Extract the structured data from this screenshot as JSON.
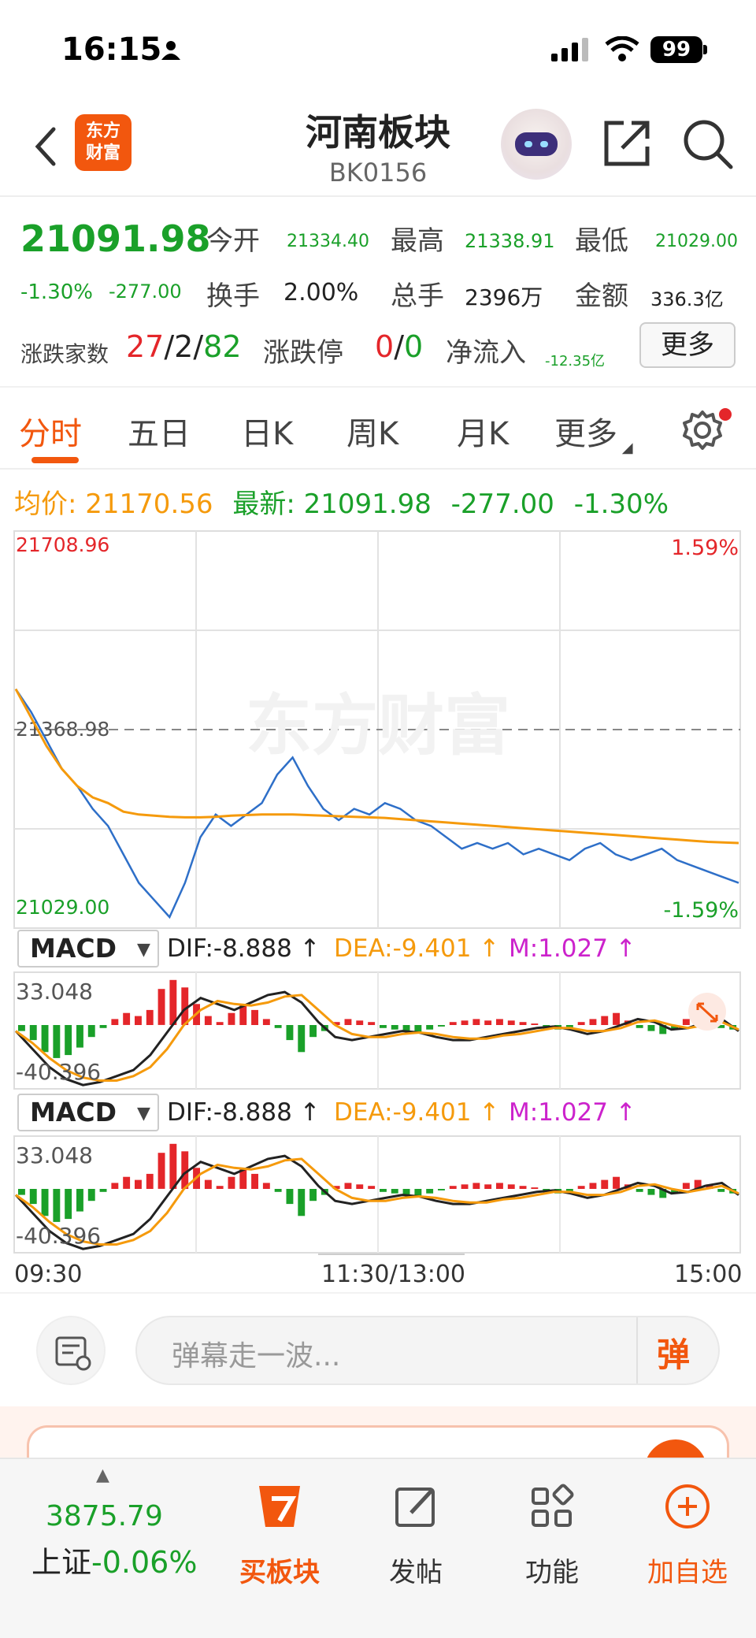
{
  "status_bar": {
    "time": "16:15",
    "battery": "99"
  },
  "header": {
    "title": "河南板块",
    "code": "BK0156",
    "logo_text": "东方财富"
  },
  "quote": {
    "price": "21091.98",
    "change_pct": "-1.30%",
    "change": "-277.00",
    "open_label": "今开",
    "open": "21334.40",
    "high_label": "最高",
    "high": "21338.91",
    "low_label": "最低",
    "low": "21029.00",
    "turnover_label": "换手",
    "turnover": "2.00%",
    "volume_label": "总手",
    "volume": "2396万",
    "amount_label": "金额",
    "amount": "336.3亿",
    "breadth_label": "涨跌家数",
    "breadth_up": "27",
    "breadth_flat": "2",
    "breadth_down": "82",
    "limit_label": "涨跌停",
    "limit_up": "0",
    "limit_down": "0",
    "netflow_label": "净流入",
    "netflow": "-12.35亿",
    "more": "更多"
  },
  "tabs": [
    "分时",
    "五日",
    "日K",
    "周K",
    "月K",
    "更多"
  ],
  "summary": {
    "avg_label": "均价:",
    "avg": "21170.56",
    "latest_label": "最新:",
    "latest": "21091.98",
    "change": "-277.00",
    "change_pct": "-1.30%"
  },
  "chart_data": [
    {
      "type": "line",
      "watermark": "东方财富",
      "ylim": [
        21029.0,
        21708.96
      ],
      "y_high_label": "21708.96",
      "y_mid_label": "21368.98",
      "y_low_label": "21029.00",
      "pct_high": "1.59%",
      "pct_low": "-1.59%",
      "x_ticks": [
        "09:30",
        "11:30/13:00",
        "15:00"
      ],
      "series": [
        {
          "color": "#2e6fc8",
          "values": [
            21440,
            21400,
            21350,
            21300,
            21270,
            21230,
            21200,
            21150,
            21100,
            21070,
            21040,
            21100,
            21180,
            21220,
            21200,
            21220,
            21240,
            21290,
            21320,
            21270,
            21230,
            21210,
            21230,
            21220,
            21240,
            21230,
            21210,
            21200,
            21180,
            21160,
            21170,
            21160,
            21170,
            21150,
            21160,
            21150,
            21140,
            21160,
            21170,
            21150,
            21140,
            21150,
            21160,
            21140,
            21130,
            21120,
            21110,
            21100
          ]
        },
        {
          "color": "#f59a0c",
          "values": [
            21440,
            21390,
            21340,
            21300,
            21270,
            21250,
            21240,
            21225,
            21220,
            21218,
            21216,
            21215,
            21215,
            21216,
            21218,
            21219,
            21220,
            21220,
            21220,
            21219,
            21218,
            21217,
            21216,
            21215,
            21214,
            21212,
            21210,
            21208,
            21206,
            21204,
            21202,
            21200,
            21198,
            21196,
            21194,
            21192,
            21190,
            21188,
            21186,
            21184,
            21182,
            21180,
            21178,
            21176,
            21174,
            21172,
            21171,
            21170
          ]
        }
      ]
    },
    {
      "type": "bar",
      "indicator": "MACD",
      "ylim": [
        -40.396,
        33.048
      ],
      "y_high_label": "33.048",
      "y_low_label": "-40.396",
      "dif_label": "DIF:-8.888 ↑",
      "dea_label": "DEA:-9.401 ↑",
      "m_label": "M:1.027 ↑",
      "hist": [
        -4,
        -10,
        -18,
        -22,
        -20,
        -15,
        -8,
        -2,
        4,
        8,
        6,
        10,
        24,
        30,
        25,
        14,
        6,
        2,
        8,
        14,
        10,
        4,
        -2,
        -10,
        -18,
        -8,
        -4,
        2,
        4,
        3,
        2,
        -2,
        -3,
        -4,
        -5,
        -3,
        -1,
        2,
        3,
        4,
        3,
        4,
        3,
        2,
        1,
        -2,
        -3,
        -2,
        2,
        4,
        6,
        8,
        3,
        -2,
        -4,
        -6,
        -3,
        4,
        6,
        3,
        -2,
        -3
      ],
      "dif": [
        -4,
        -16,
        -28,
        -36,
        -40,
        -38,
        -34,
        -30,
        -20,
        -5,
        10,
        18,
        14,
        10,
        15,
        20,
        22,
        15,
        2,
        -8,
        -10,
        -8,
        -6,
        -4,
        -5,
        -8,
        -10,
        -10,
        -8,
        -6,
        -4,
        -2,
        -1,
        -3,
        -6,
        -4,
        0,
        4,
        2,
        -3,
        -2,
        2,
        4,
        -4
      ],
      "dea": [
        -4,
        -12,
        -22,
        -30,
        -35,
        -37,
        -37,
        -34,
        -28,
        -16,
        0,
        10,
        16,
        14,
        13,
        15,
        19,
        20,
        10,
        0,
        -6,
        -8,
        -8,
        -6,
        -5,
        -6,
        -8,
        -9,
        -9,
        -7,
        -6,
        -4,
        -2,
        -2,
        -4,
        -4,
        -2,
        2,
        3,
        0,
        -2,
        0,
        2,
        -3
      ]
    },
    {
      "type": "bar",
      "indicator": "MACD",
      "ylim": [
        -40.396,
        33.048
      ],
      "y_high_label": "33.048",
      "y_low_label": "-40.396",
      "dif_label": "DIF:-8.888 ↑",
      "dea_label": "DEA:-9.401 ↑",
      "m_label": "M:1.027 ↑"
    }
  ],
  "danmu": {
    "placeholder": "弹幕走一波...",
    "button": "弹"
  },
  "bottom_bar": {
    "index_value": "3875.79",
    "index_name": "上证",
    "index_pct": "-0.06%",
    "items": [
      "买板块",
      "发帖",
      "功能",
      "加自选"
    ]
  },
  "colors": {
    "accent": "#f2570e",
    "up": "#e4262a",
    "down": "#1aa029",
    "avg": "#f59a0c",
    "price_line": "#2e6fc8"
  }
}
